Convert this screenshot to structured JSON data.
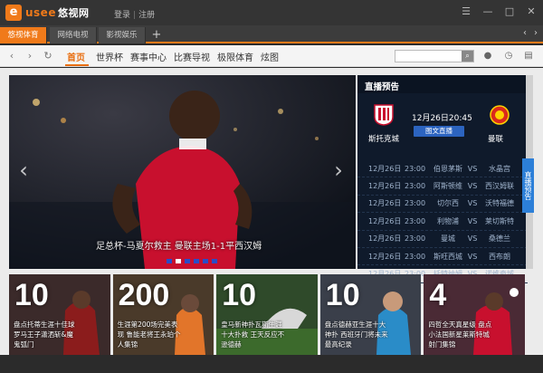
{
  "app": {
    "logo_letter": "e",
    "brand": "usee",
    "brand_cn": "悠视网",
    "login": "登录",
    "register": "注册"
  },
  "tabs": [
    {
      "label": "悠视体育",
      "active": true
    },
    {
      "label": "网络电视",
      "active": false
    },
    {
      "label": "影视娱乐",
      "active": false
    }
  ],
  "nav": {
    "items": [
      "首页",
      "世界杯",
      "赛事中心",
      "比赛导视",
      "极限体育",
      "炫图"
    ],
    "active_index": 0,
    "search_placeholder": ""
  },
  "hero": {
    "caption": "足总杯-马夏尔救主 曼联主场1-1平西汉姆",
    "slide_count": 6,
    "active_slide": 1
  },
  "live": {
    "title": "直播预告",
    "home_team": "斯托克城",
    "away_team": "曼联",
    "datetime": "12月26日20:45",
    "button": "图文直播",
    "side_tab": "直播预告",
    "schedule": [
      {
        "date": "12月26日",
        "time": "23:00",
        "home": "伯恩茅斯",
        "vs": "VS",
        "away": "水晶宫"
      },
      {
        "date": "12月26日",
        "time": "23:00",
        "home": "阿斯顿维",
        "vs": "VS",
        "away": "西汉姆联"
      },
      {
        "date": "12月26日",
        "time": "23:00",
        "home": "切尔西",
        "vs": "VS",
        "away": "沃特福德"
      },
      {
        "date": "12月26日",
        "time": "23:00",
        "home": "利物浦",
        "vs": "VS",
        "away": "莱切斯特"
      },
      {
        "date": "12月26日",
        "time": "23:00",
        "home": "曼城",
        "vs": "VS",
        "away": "桑德兰"
      },
      {
        "date": "12月26日",
        "time": "23:00",
        "home": "斯旺西城",
        "vs": "VS",
        "away": "西布朗"
      },
      {
        "date": "12月26日",
        "time": "23:00",
        "home": "托特纳姆",
        "vs": "VS",
        "away": "诺维奇城"
      }
    ]
  },
  "thumbs": [
    {
      "num": "10",
      "text": "盘点托蒂生涯十佳球 罗马王子潇洒斩&魔鬼弧门",
      "bg": "#7a2d2d"
    },
    {
      "num": "200",
      "text": "生涯第200场完美表现 鲁能老将王永珀个人集锦",
      "bg": "#5a4a3a"
    },
    {
      "num": "10",
      "text": "皇马新神扑瓦斯生涯十大扑救 王天反应不逊德赫",
      "bg": "#3e5a2e"
    },
    {
      "num": "10",
      "text": "盘点德赫亚生涯十大神扑 西班牙门将未来最高纪录",
      "bg": "#4a4f5a"
    },
    {
      "num": "4",
      "text": "四哲全天真星级 盘点小法国新星莱斯特城射门集锦",
      "bg": "#6a3b4a"
    }
  ],
  "colors": {
    "accent": "#f07a1a",
    "nav_active": "#e86e10",
    "live_bg": "#0f1a2b",
    "button_blue": "#2c64c0"
  }
}
